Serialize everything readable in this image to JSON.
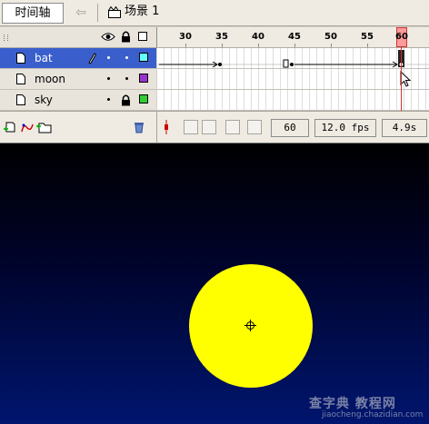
{
  "topbar": {
    "timeline_label": "时间轴",
    "scene_label": "场景 1"
  },
  "ruler": {
    "ticks": [
      "30",
      "35",
      "40",
      "45",
      "50",
      "55",
      "60"
    ],
    "current_frame": 60
  },
  "layers": [
    {
      "name": "bat",
      "color": "#66ffff",
      "selected": true
    },
    {
      "name": "moon",
      "color": "#9933cc",
      "selected": false
    },
    {
      "name": "sky",
      "color": "#33cc33",
      "selected": false
    }
  ],
  "controls": {
    "frame": "60",
    "fps": "12.0 fps",
    "time": "4.9s"
  },
  "stage": {
    "watermark_top": "查字典 教程网",
    "watermark_bottom": "jiaocheng.chazidian.com"
  },
  "icons": [
    "back-arrow-icon",
    "scene-icon",
    "eye-icon",
    "lock-icon",
    "outline-icon",
    "page-icon",
    "pencil-icon",
    "add-layer-icon",
    "add-guide-icon",
    "add-folder-icon",
    "trash-icon",
    "center-frame-icon",
    "onion-skin-icon",
    "onion-outline-icon",
    "edit-multiple-icon",
    "onion-markers-icon"
  ],
  "colors": {
    "selected_layer": "#3a5fcd",
    "playhead": "#ff9a9a",
    "moon": "#ffff00",
    "stage_top": "#000000",
    "stage_bottom": "#00156e"
  }
}
